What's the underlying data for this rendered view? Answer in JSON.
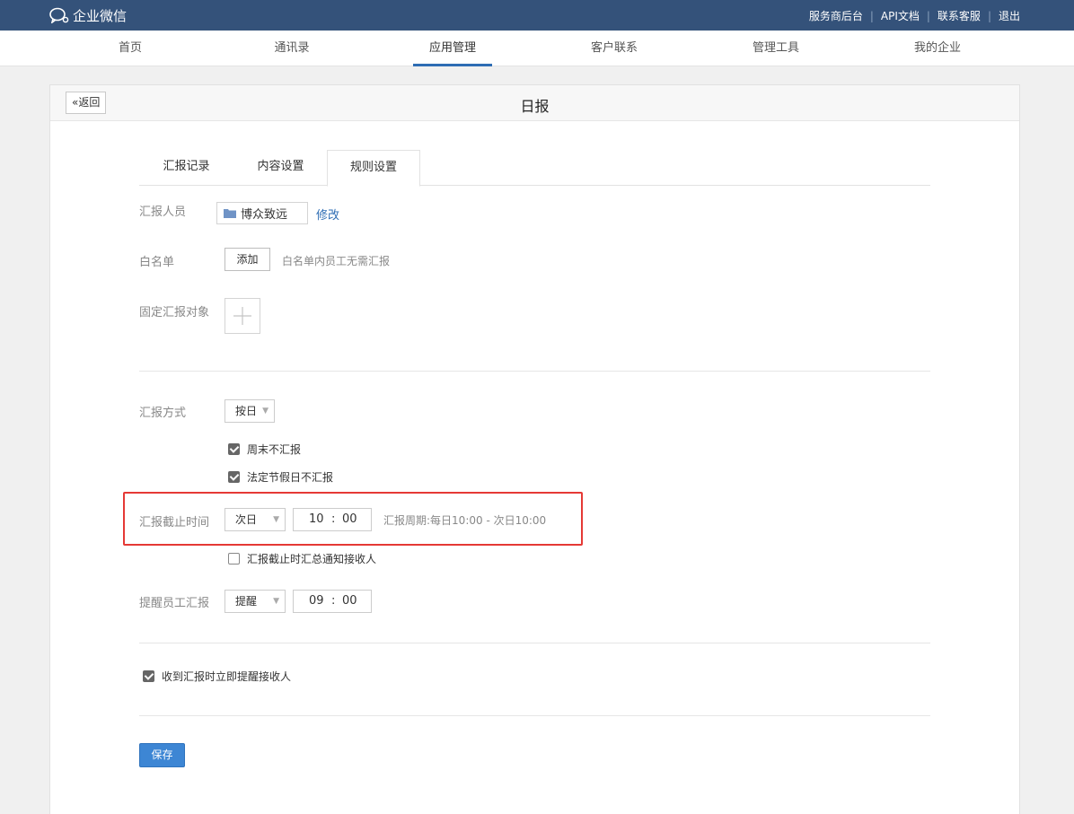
{
  "topbar": {
    "logo_text": "企业微信",
    "links": [
      "服务商后台",
      "API文档",
      "联系客服",
      "退出"
    ]
  },
  "nav": {
    "items": [
      "首页",
      "通讯录",
      "应用管理",
      "客户联系",
      "管理工具",
      "我的企业"
    ],
    "active": "应用管理"
  },
  "panel": {
    "back_label": "返回",
    "title": "日报"
  },
  "tabs": [
    "汇报记录",
    "内容设置",
    "规则设置"
  ],
  "form": {
    "reporters_label": "汇报人员",
    "reporters_value": "博众致远",
    "reporters_edit": "修改",
    "whitelist_label": "白名单",
    "whitelist_add": "添加",
    "whitelist_hint": "白名单内员工无需汇报",
    "fixed_target_label": "固定汇报对象",
    "method_label": "汇报方式",
    "method_value": "按日",
    "opt_weekend": "周末不汇报",
    "opt_weekend_checked": true,
    "opt_holiday": "法定节假日不汇报",
    "opt_holiday_checked": true,
    "deadline_label": "汇报截止时间",
    "deadline_day": "次日",
    "deadline_hour": "10",
    "deadline_min": "00",
    "deadline_hint": "汇报周期:每日10:00 - 次日10:00",
    "opt_notify": "汇报截止时汇总通知接收人",
    "opt_notify_checked": false,
    "remind_label": "提醒员工汇报",
    "remind_value": "提醒",
    "remind_hour": "09",
    "remind_min": "00",
    "opt_receive": "收到汇报时立即提醒接收人",
    "opt_receive_checked": true,
    "save_label": "保存"
  },
  "colors": {
    "topbar": "#34527a",
    "accent": "#2e6db4",
    "save": "#3d86d4",
    "highlight": "#e53935"
  }
}
